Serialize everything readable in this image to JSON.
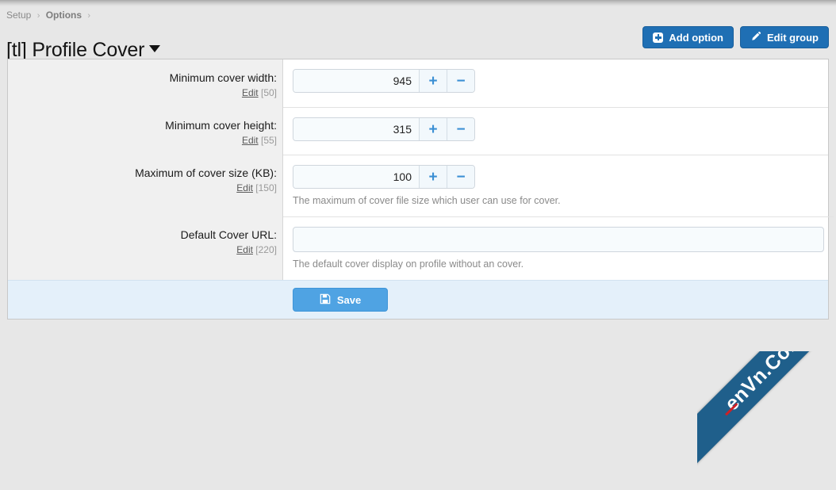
{
  "breadcrumb": {
    "items": [
      {
        "label": "Setup",
        "bold": false
      },
      {
        "label": "Options",
        "bold": true
      }
    ],
    "separator": "›"
  },
  "header": {
    "title": "[tl] Profile Cover",
    "caret_icon": "chevron-down-icon",
    "buttons": [
      {
        "label": "Add option",
        "icon": "plus-square-icon"
      },
      {
        "label": "Edit group",
        "icon": "pencil-icon"
      }
    ]
  },
  "form": {
    "rows": [
      {
        "label": "Minimum cover width:",
        "edit_label": "Edit",
        "option_id": "[50]",
        "type": "stepper",
        "value": "945",
        "increment_label": "+",
        "decrement_label": "−",
        "hint": ""
      },
      {
        "label": "Minimum cover height:",
        "edit_label": "Edit",
        "option_id": "[55]",
        "type": "stepper",
        "value": "315",
        "increment_label": "+",
        "decrement_label": "−",
        "hint": ""
      },
      {
        "label": "Maximum of cover size (KB):",
        "edit_label": "Edit",
        "option_id": "[150]",
        "type": "stepper",
        "value": "100",
        "increment_label": "+",
        "decrement_label": "−",
        "hint": "The maximum of cover file size which user can use for cover."
      },
      {
        "label": "Default Cover URL:",
        "edit_label": "Edit",
        "option_id": "[220]",
        "type": "text",
        "value": "",
        "placeholder": "",
        "hint": "The default cover display on profile without an cover."
      }
    ]
  },
  "footer": {
    "save_label": "Save",
    "save_icon": "floppy-disk-icon"
  },
  "watermark": {
    "text": "enVn.Com"
  },
  "colors": {
    "accent_blue": "#1f6fb4",
    "save_blue": "#4fa3e3",
    "stepper_glyph": "#3b8fd4",
    "footer_bg": "#e4f0fa",
    "gutter_bg": "#f0f0f0",
    "page_bg": "#e7e7e7",
    "watermark_band": "#1f5f8b",
    "watermark_dash": "#cc2127"
  }
}
